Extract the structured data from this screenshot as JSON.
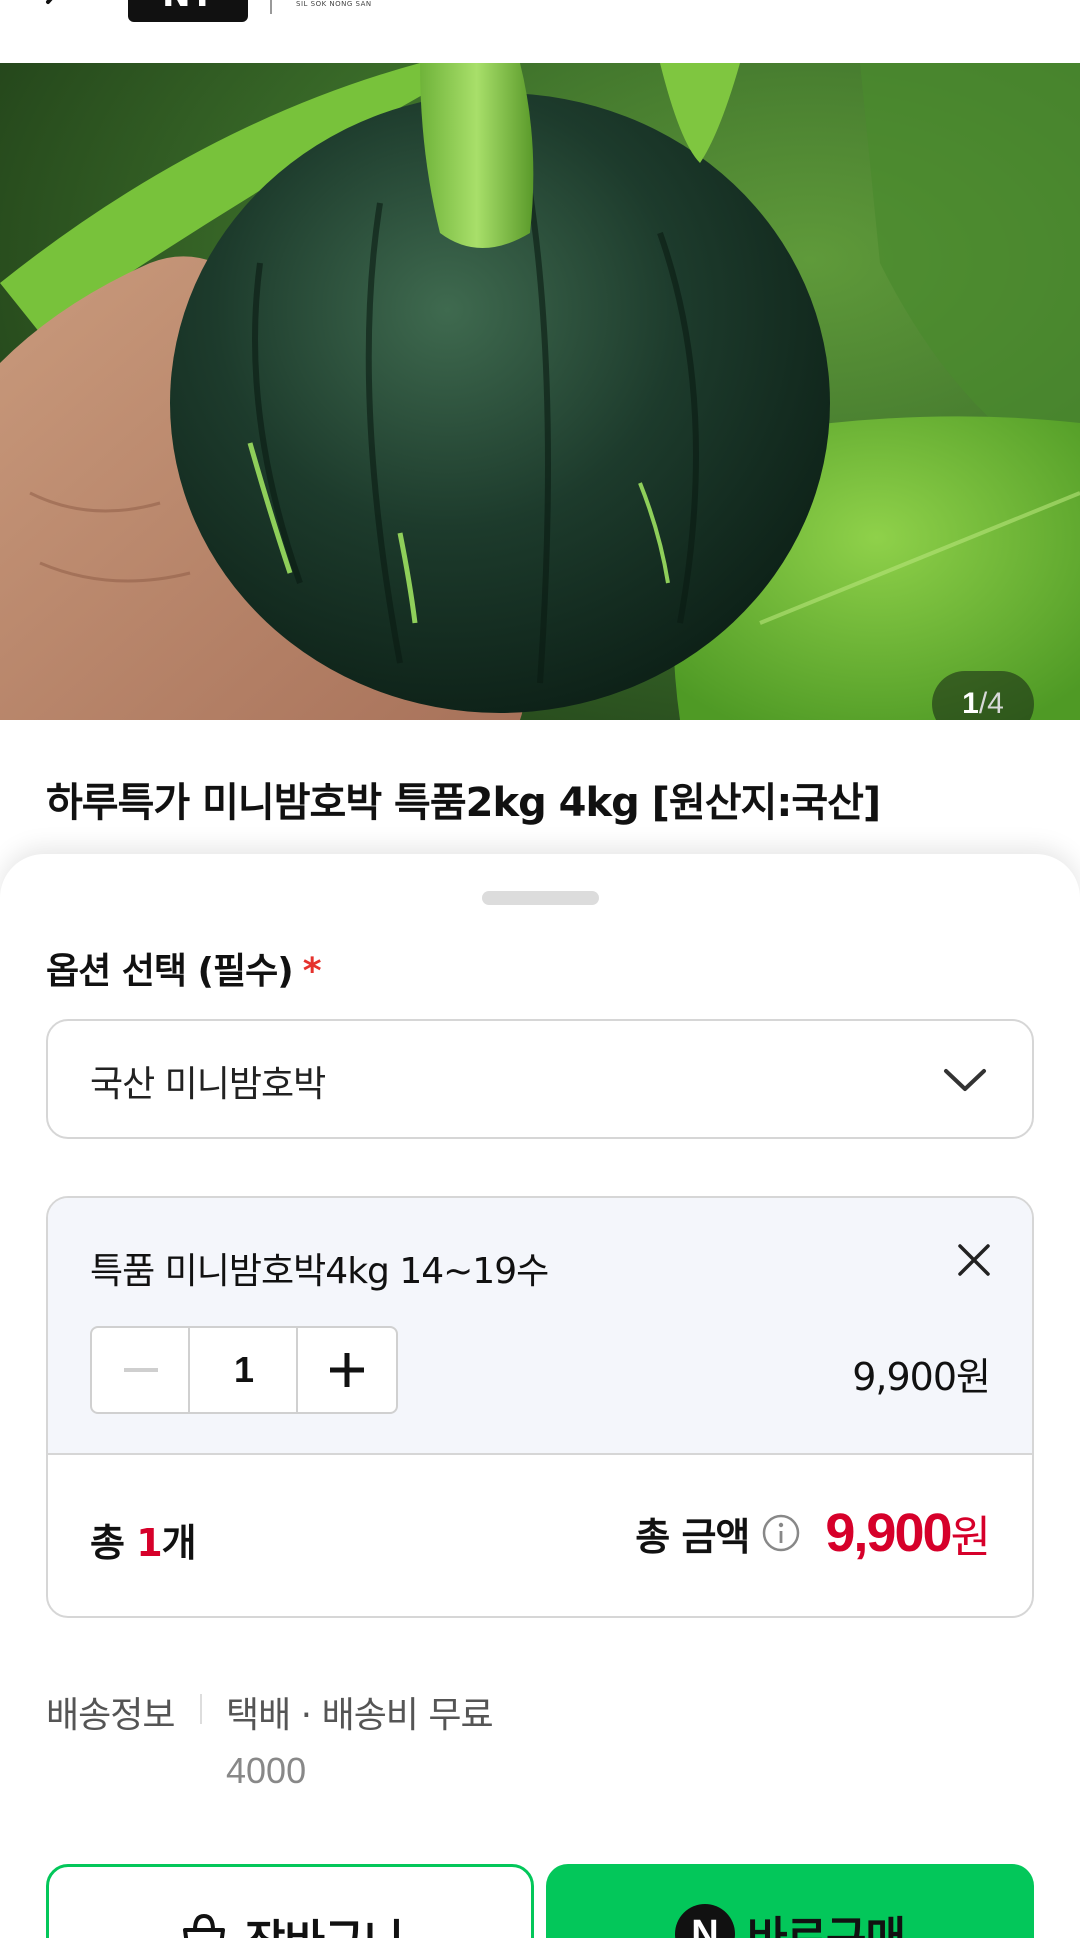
{
  "header": {
    "logo_text": "NT",
    "logo_subtitle": "SIL SOK NONG SAN"
  },
  "hero": {
    "counter_current": "1",
    "counter_separator": "/",
    "counter_total": "4"
  },
  "product": {
    "title": "하루특가 미니밤호박 특품2kg 4kg [원산지:국산]"
  },
  "option": {
    "label": "옵션 선택 (필수)",
    "required_mark": "*",
    "selected_value": "국산 미니밤호박"
  },
  "selected_item": {
    "name": "특품 미니밤호박4kg 14~19수",
    "quantity": "1",
    "price": "9,900원"
  },
  "total": {
    "count_prefix": "총",
    "count_value": "1",
    "count_suffix": "개",
    "amount_label": "총 금액",
    "amount_value": "9,900",
    "amount_unit": "원"
  },
  "shipping": {
    "label": "배송정보",
    "method": "택배 · 배송비 무료",
    "fee": "4000"
  },
  "buttons": {
    "cart_label": "장바구니",
    "buy_label": "바로구매",
    "buy_badge": "N"
  },
  "colors": {
    "accent_green": "#03c75a",
    "price_red": "#d6002a",
    "required_red": "#e5322d"
  }
}
